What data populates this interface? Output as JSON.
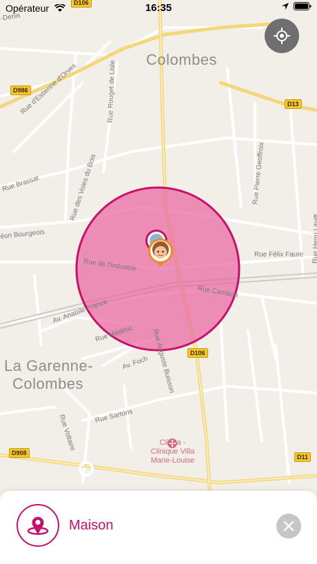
{
  "status_bar": {
    "carrier": "Opérateur",
    "time": "16:35"
  },
  "map": {
    "cities": [
      "Colombes",
      "La Garenne-",
      "Colombes"
    ],
    "roads": [
      "D106",
      "D986",
      "D13",
      "D106",
      "D908",
      "D11"
    ],
    "streets": [
      "Rue d'Estienne d'Orves",
      "Rue Rouget de Lisle",
      "Rue Brassat",
      "Rue des Voies du Bois",
      "Rue Pierre Geoffroix",
      "Rue Félix Faure",
      "Rue de l'Industrie",
      "Rue Cambon",
      "Av. Anatole France",
      "Rue Médéric",
      "Av. Foch",
      "Rue Auguste Buisson",
      "Rue Sartoris",
      "Rue Voltaire",
      "Rue Henri Litolff",
      "éon Bourgeois",
      "-Denis"
    ],
    "poi": {
      "line1": "Clinea -",
      "line2": "Clinique Villa",
      "line3": "Marie-Louise"
    },
    "geofence_color": "#c8106a"
  },
  "panel": {
    "zone_name": "Maison",
    "accent": "#c8106a"
  }
}
